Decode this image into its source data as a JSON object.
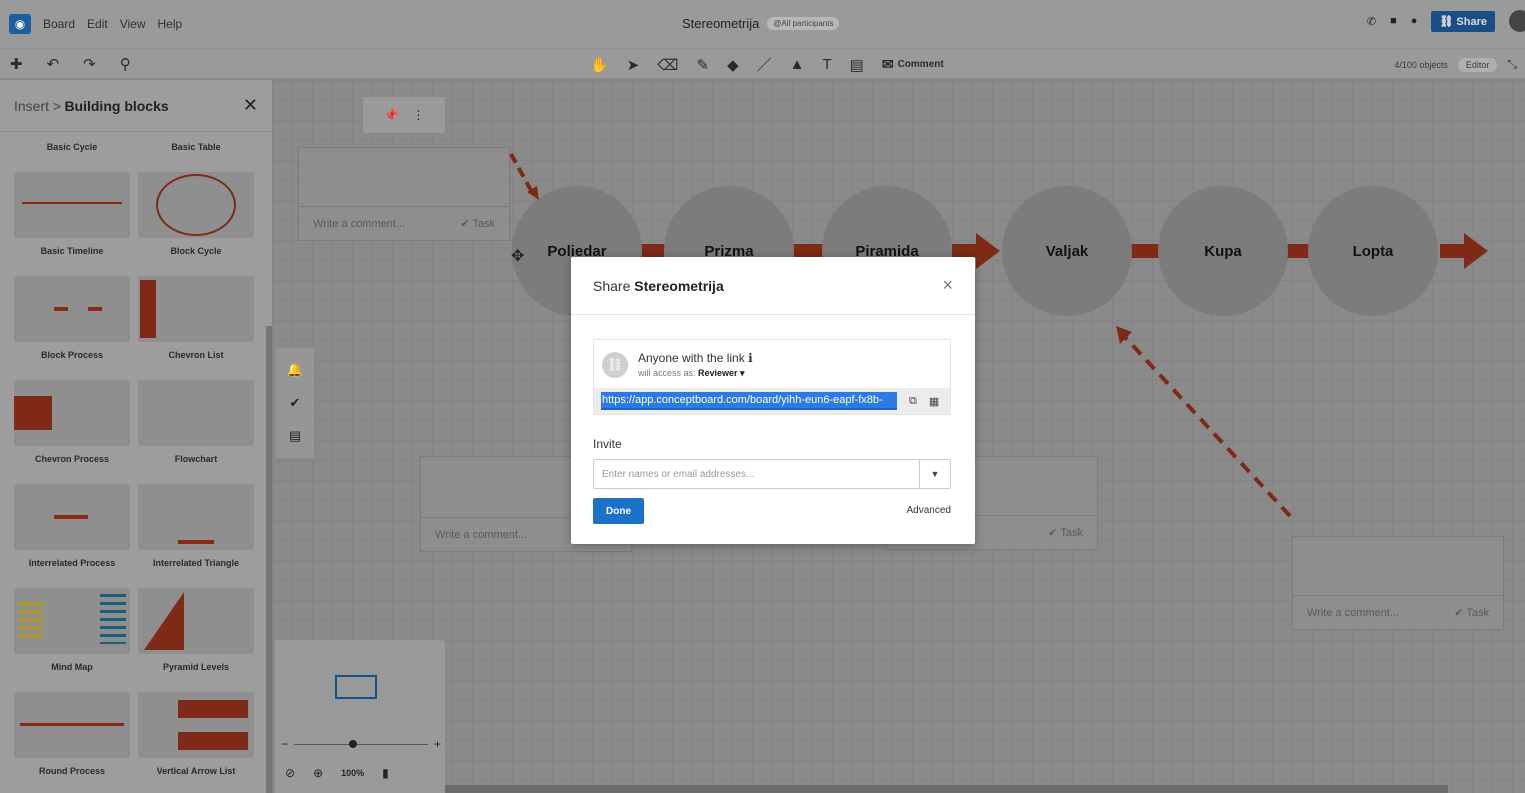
{
  "menubar": {
    "items": [
      "Board",
      "Edit",
      "View",
      "Help"
    ]
  },
  "board_title": "Stereometrija",
  "participants_pill": "@All participants",
  "share_button": "Share",
  "toolbar": {
    "comment_label": "Comment",
    "objects_count": "4/100 objects",
    "mode": "Editor"
  },
  "sidebar": {
    "breadcrumb": "Insert >",
    "title": "Building blocks",
    "blocks": [
      "Basic Cycle",
      "Basic Table",
      "Basic Timeline",
      "Block Cycle",
      "Block Process",
      "Chevron List",
      "Chevron Process",
      "Flowchart",
      "Interrelated Process",
      "Interrelated Triangle",
      "Mind Map",
      "Pyramid Levels",
      "Round Process",
      "Vertical Arrow List"
    ]
  },
  "canvas": {
    "circles": [
      "Poliedar",
      "Prizma",
      "Piramida",
      "Valjak",
      "Kupa",
      "Lopta"
    ],
    "comment_placeholder": "Write a comment...",
    "task_label": "Task"
  },
  "minimap": {
    "zoom": "100%"
  },
  "modal": {
    "title_prefix": "Share",
    "title_board": "Stereometrija",
    "anyone_label": "Anyone with the link",
    "access_prefix": "will access as:",
    "access_role": "Reviewer ▾",
    "url": "https://app.conceptboard.com/board/yihh-eun6-eapf-fx8b-",
    "invite_label": "Invite",
    "invite_placeholder": "Enter names or email addresses...",
    "done_label": "Done",
    "advanced_label": "Advanced"
  }
}
